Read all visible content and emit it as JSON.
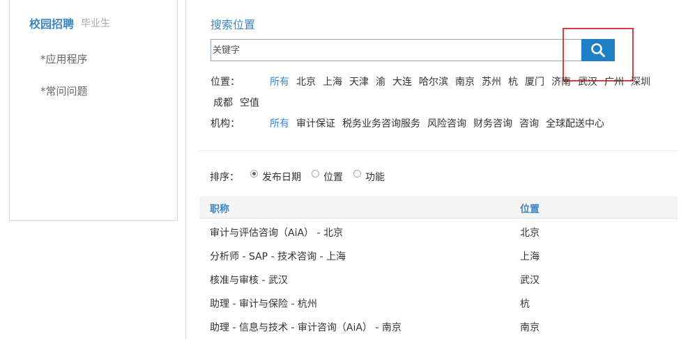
{
  "sidebar": {
    "title": "校园招聘",
    "subtitle": "毕业生",
    "items": [
      {
        "label": "*应用程序"
      },
      {
        "label": "*常问问题"
      }
    ]
  },
  "search": {
    "title": "搜索位置",
    "placeholder": "关键字",
    "button_icon": "search-icon"
  },
  "filters": {
    "location": {
      "label": "位置：",
      "options": [
        "所有",
        "北京",
        "上海",
        "天津",
        "渝",
        "大连",
        "哈尔滨",
        "南京",
        "苏州",
        "杭",
        "厦门",
        "济南",
        "武汉",
        "广州",
        "深圳",
        "成都",
        "空值"
      ]
    },
    "org": {
      "label": "机构：",
      "options": [
        "所有",
        "审计保证",
        "税务业务咨询服务",
        "风险咨询",
        "财务咨询",
        "咨询",
        "全球配送中心"
      ]
    }
  },
  "sort": {
    "label": "排序：",
    "options": [
      {
        "label": "发布日期",
        "checked": true
      },
      {
        "label": "位置",
        "checked": false
      },
      {
        "label": "功能",
        "checked": false
      }
    ]
  },
  "table": {
    "headers": [
      "职称",
      "位置"
    ],
    "rows": [
      [
        "审计与评估咨询（AiA） - 北京",
        "北京"
      ],
      [
        "分析师 - SAP - 技术咨询 - 上海",
        "上海"
      ],
      [
        "核准与审核 - 武汉",
        "武汉"
      ],
      [
        "助理 - 审计与保险 - 杭州",
        "杭"
      ],
      [
        "助理 - 信息与技术 - 审计咨询（AiA） - 南京",
        "南京"
      ]
    ]
  },
  "colors": {
    "accent": "#3f86c6",
    "button": "#1e7fc5",
    "highlight": "#e03a3a"
  }
}
